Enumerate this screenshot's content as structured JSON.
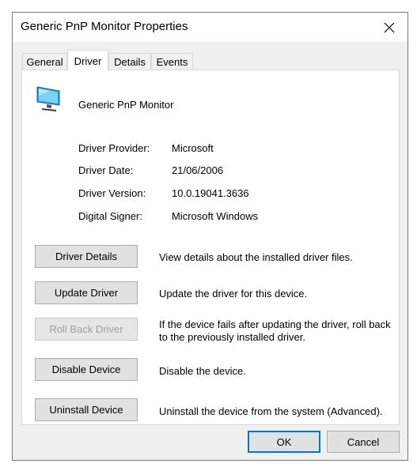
{
  "window": {
    "title": "Generic PnP Monitor Properties"
  },
  "tabs": [
    {
      "label": "General"
    },
    {
      "label": "Driver"
    },
    {
      "label": "Details"
    },
    {
      "label": "Events"
    }
  ],
  "active_tab": "Driver",
  "device": {
    "name": "Generic PnP Monitor",
    "icon": "monitor-icon"
  },
  "properties": [
    {
      "label": "Driver Provider:",
      "value": "Microsoft"
    },
    {
      "label": "Driver Date:",
      "value": "21/06/2006"
    },
    {
      "label": "Driver Version:",
      "value": "10.0.19041.3636"
    },
    {
      "label": "Digital Signer:",
      "value": "Microsoft Windows"
    }
  ],
  "actions": [
    {
      "label": "Driver Details",
      "description": "View details about the installed driver files.",
      "enabled": true
    },
    {
      "label": "Update Driver",
      "description": "Update the driver for this device.",
      "enabled": true
    },
    {
      "label": "Roll Back Driver",
      "description": "If the device fails after updating the driver, roll back to the previously installed driver.",
      "enabled": false
    },
    {
      "label": "Disable Device",
      "description": "Disable the device.",
      "enabled": true
    },
    {
      "label": "Uninstall Device",
      "description": "Uninstall the device from the system (Advanced).",
      "enabled": true
    }
  ],
  "footer": {
    "ok_label": "OK",
    "cancel_label": "Cancel"
  },
  "colors": {
    "accent": "#0078d7",
    "dialog_bg": "#f0f0f0",
    "panel_bg": "#ffffff",
    "button_bg": "#e1e1e1",
    "disabled_text": "#a0a0a0"
  }
}
